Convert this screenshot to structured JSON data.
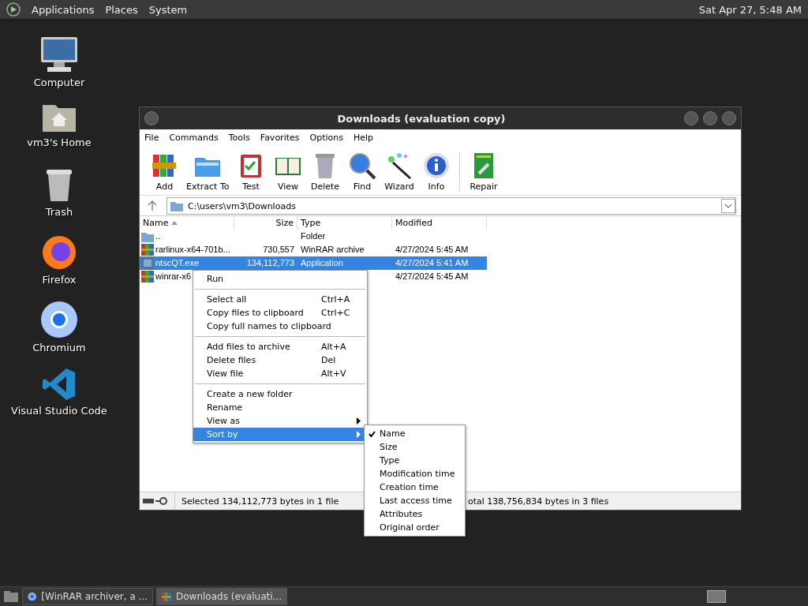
{
  "top_panel": {
    "menus": [
      "Applications",
      "Places",
      "System"
    ],
    "clock": "Sat Apr 27,  5:48 AM"
  },
  "desktop_icons": [
    {
      "kind": "computer",
      "label": "Computer"
    },
    {
      "kind": "home",
      "label": "vm3's Home"
    },
    {
      "kind": "trash",
      "label": "Trash"
    },
    {
      "kind": "firefox",
      "label": "Firefox"
    },
    {
      "kind": "chromium",
      "label": "Chromium"
    },
    {
      "kind": "vscode",
      "label": "Visual Studio Code"
    }
  ],
  "window": {
    "title": "Downloads (evaluation copy)",
    "menu_bar": [
      "File",
      "Commands",
      "Tools",
      "Favorites",
      "Options",
      "Help"
    ],
    "toolbar": [
      {
        "kind": "add",
        "label": "Add"
      },
      {
        "kind": "extract",
        "label": "Extract To"
      },
      {
        "kind": "test",
        "label": "Test"
      },
      {
        "kind": "view",
        "label": "View"
      },
      {
        "kind": "delete",
        "label": "Delete"
      },
      {
        "kind": "find",
        "label": "Find"
      },
      {
        "kind": "wizard",
        "label": "Wizard"
      },
      {
        "kind": "info",
        "label": "Info"
      },
      {
        "kind": "repair",
        "label": "Repair"
      }
    ],
    "address": "C:\\users\\vm3\\Downloads",
    "columns": [
      "Name",
      "Size",
      "Type",
      "Modified"
    ],
    "rows": [
      {
        "kind": "folder",
        "name": "..",
        "type": "Folder",
        "selected": false
      },
      {
        "kind": "archive",
        "name": "rarlinux-x64-701b...",
        "size": "730,557",
        "type": "WinRAR archive",
        "modified": "4/27/2024 5:45 AM",
        "selected": false
      },
      {
        "kind": "app",
        "name": "ntscQT.exe",
        "size": "134,112,773",
        "type": "Application",
        "modified": "4/27/2024 5:41 AM",
        "selected": true
      },
      {
        "kind": "archive",
        "name": "winrar-x6",
        "modified": "4/27/2024 5:45 AM",
        "selected": false
      }
    ],
    "status_left": "Selected 134,112,773 bytes in 1 file",
    "status_right": "otal 138,756,834 bytes in 3 files"
  },
  "context_menu": {
    "groups": [
      [
        {
          "label": "Run",
          "submenu": false,
          "selected": false
        }
      ],
      [
        {
          "label": "Select all",
          "shortcut": "Ctrl+A",
          "submenu": false,
          "selected": false
        },
        {
          "label": "Copy files to clipboard",
          "shortcut": "Ctrl+C",
          "submenu": false,
          "selected": false
        },
        {
          "label": "Copy full names to clipboard",
          "submenu": false,
          "selected": false
        }
      ],
      [
        {
          "label": "Add files to archive",
          "shortcut": "Alt+A",
          "submenu": false,
          "selected": false
        },
        {
          "label": "Delete files",
          "shortcut": "Del",
          "submenu": false,
          "selected": false
        },
        {
          "label": "View file",
          "shortcut": "Alt+V",
          "submenu": false,
          "selected": false
        }
      ],
      [
        {
          "label": "Create a new folder",
          "submenu": false,
          "selected": false
        },
        {
          "label": "Rename",
          "submenu": false,
          "selected": false
        },
        {
          "label": "View as",
          "submenu": true,
          "selected": false
        },
        {
          "label": "Sort by",
          "submenu": true,
          "selected": true
        }
      ]
    ]
  },
  "sort_submenu": [
    {
      "label": "Name",
      "checked": true
    },
    {
      "label": "Size",
      "checked": false
    },
    {
      "label": "Type",
      "checked": false
    },
    {
      "label": "Modification time",
      "checked": false
    },
    {
      "label": "Creation time",
      "checked": false
    },
    {
      "label": "Last access time",
      "checked": false
    },
    {
      "label": "Attributes",
      "checked": false
    },
    {
      "label": "Original order",
      "checked": false
    }
  ],
  "taskbar": [
    {
      "kind": "browser",
      "label": "[WinRAR archiver, a ...",
      "selected": false
    },
    {
      "kind": "archive",
      "label": "Downloads (evaluati...",
      "selected": true
    }
  ]
}
